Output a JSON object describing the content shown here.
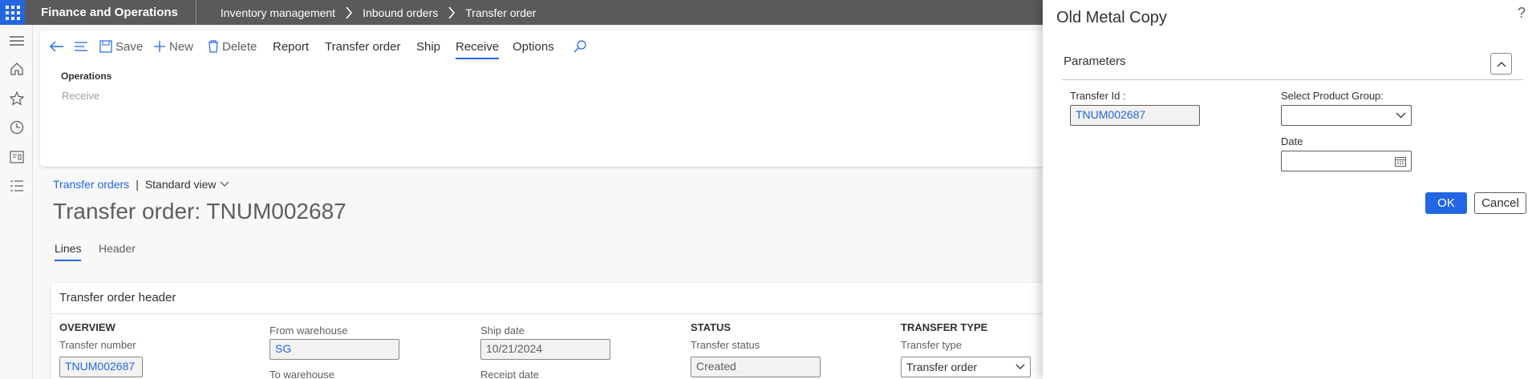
{
  "app": {
    "title": "Finance and Operations"
  },
  "breadcrumbs": [
    "Inventory management",
    "Inbound orders",
    "Transfer order"
  ],
  "actions": {
    "save": "Save",
    "new": "New",
    "delete": "Delete",
    "report": "Report",
    "transfer_order": "Transfer order",
    "ship": "Ship",
    "receive": "Receive",
    "options": "Options"
  },
  "action_pane": {
    "group_title": "Operations",
    "group_item": "Receive"
  },
  "page": {
    "breadcrumb_link": "Transfer orders",
    "view": "Standard view",
    "title": "Transfer order: TNUM002687",
    "tabs": [
      "Lines",
      "Header"
    ]
  },
  "header_card": {
    "title": "Transfer order header",
    "overview_label": "OVERVIEW",
    "transfer_number_label": "Transfer number",
    "transfer_number": "TNUM002687",
    "from_warehouse_label": "From warehouse",
    "from_warehouse": "SG",
    "to_warehouse_label": "To warehouse",
    "ship_date_label": "Ship date",
    "ship_date": "10/21/2024",
    "receipt_date_label": "Receipt date",
    "status_label": "STATUS",
    "transfer_status_label": "Transfer status",
    "transfer_status": "Created",
    "transfer_type_section": "TRANSFER TYPE",
    "transfer_type_label": "Transfer type",
    "transfer_type": "Transfer order"
  },
  "dialog": {
    "title": "Old Metal Copy",
    "help": "?",
    "section": "Parameters",
    "transfer_id_label": "Transfer Id :",
    "transfer_id": "TNUM002687",
    "product_group_label": "Select Product Group:",
    "product_group": "",
    "date_label": "Date",
    "date": "",
    "ok": "OK",
    "cancel": "Cancel"
  },
  "colors": {
    "accent": "#2266e3",
    "topbar": "#5a5a5a"
  }
}
